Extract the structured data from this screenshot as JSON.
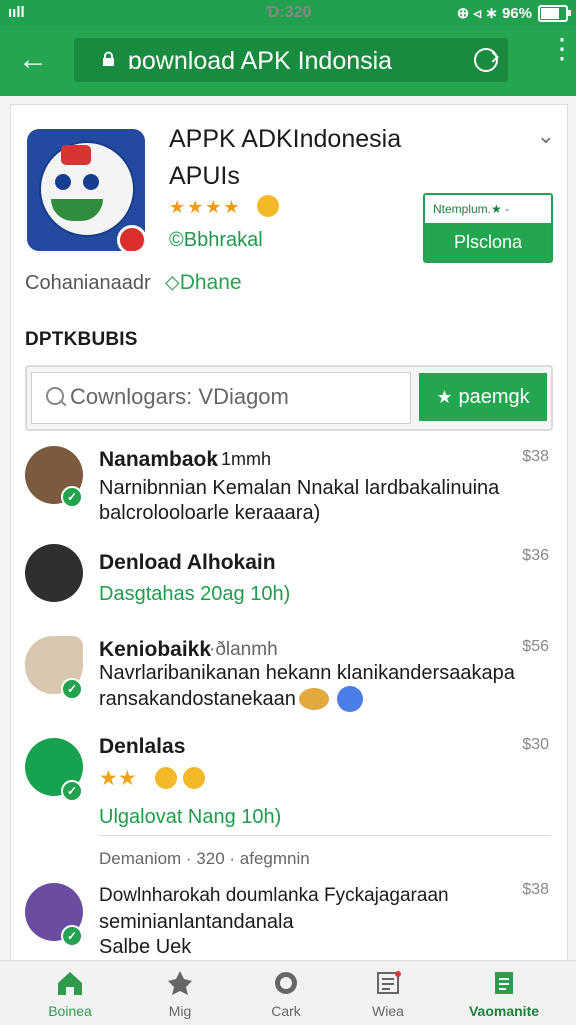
{
  "statusbar": {
    "left": "ııll",
    "time": "Ɗ:320",
    "right": "⊕ ◃ ∗ 96%"
  },
  "toolbar": {
    "url": "ɒownload APK Indonsia"
  },
  "app": {
    "title_line1": "APPK ADKIndonesia",
    "title_line2": "APUIs",
    "stars": "★★★★",
    "developer": "©Bbhrakal",
    "install_top": "Ntemplum.★ -",
    "install_label": "Plsclona",
    "subtitle_left": "Cohanianaadr",
    "subtitle_right": "⬦Dhane"
  },
  "section_title": "DPTKBUBIS",
  "search": {
    "placeholder": "Cownlogars:     VDiagom",
    "button": "paemgk"
  },
  "items": [
    {
      "name": "Nanambaok",
      "meta": ": 1mmh",
      "time": "$38",
      "body1": "Narnibnnian Kemalan Nnakal lardbakalinuina",
      "body2": "balcrolooloarle keraaara)"
    },
    {
      "name": "Denload Alhokain",
      "time": "$36",
      "body1": "Dasgtahas 20ag 10h)"
    },
    {
      "name": "Keniobaikk",
      "meta": "·ðlanmh",
      "time": "$56",
      "body1": "Navrlaribanikanan hekann klanikandersaakapa",
      "body2": "ransakandostanekaan"
    },
    {
      "name": "Denlalas",
      "time": "$30",
      "body2": "Ulgalovat Nang 10h)"
    },
    {
      "name": "Dowlnharokah doumlanka Fyckajagaraan",
      "time": "$38",
      "body1": "seminianlantandanala",
      "body2": "Salbe Uek"
    }
  ],
  "meta_line": "Demaniom · 320 · afegmnin",
  "nav": [
    {
      "label": "Boinea"
    },
    {
      "label": "Mig"
    },
    {
      "label": "Cark"
    },
    {
      "label": "Wiea"
    },
    {
      "label": "Vaomanite"
    }
  ]
}
